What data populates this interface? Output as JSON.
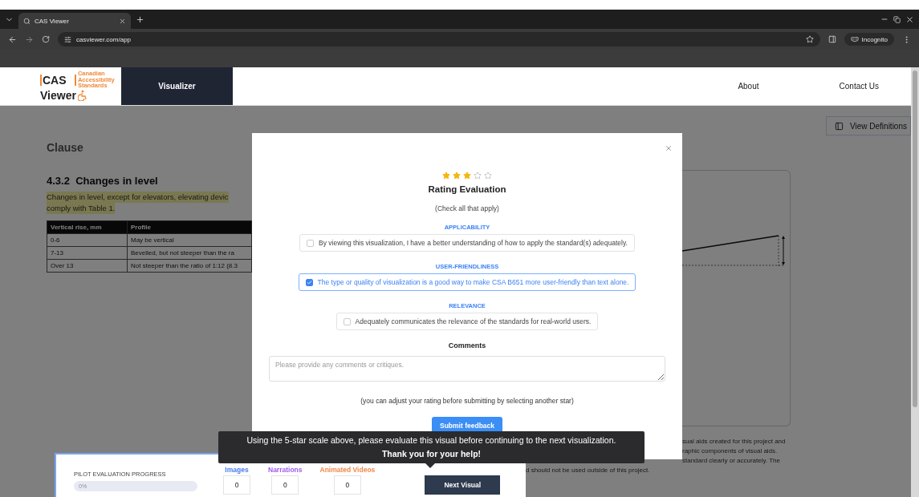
{
  "browser": {
    "tab_title": "CAS Viewer",
    "url": "casviewer.com/app",
    "profile": "Incognito"
  },
  "nav": {
    "logo": {
      "top": "CAS",
      "bottom": "Viewer",
      "tagline": [
        "Canadian",
        "Accessibility",
        "Standards"
      ]
    },
    "items": [
      {
        "label": "Visualizer",
        "selected": true
      },
      {
        "label": "About",
        "selected": false
      },
      {
        "label": "Contact Us",
        "selected": false
      }
    ]
  },
  "content": {
    "heading": "Clause",
    "clause_title": "4.3.2  Changes in level",
    "clause_text": [
      "Changes in level, except for elevators, elevating devic",
      "comply with Table 1."
    ],
    "table": {
      "columns": [
        "Vertical rise, mm",
        "Profile"
      ],
      "rows": [
        [
          "0-6",
          "May be vertical"
        ],
        [
          "7-13",
          "Bevelled, but not steeper than the ra"
        ],
        [
          "Over 13",
          "Not steeper than the ratio of 1:12 (8.3"
        ]
      ]
    },
    "definitions_button": "View Definitions",
    "disclaimer": [
      {
        "text": "sual aids created for this project and",
        "indented": true
      },
      {
        "text": "raphic components of visual aids.",
        "indented": true
      },
      {
        "text": "standard clearly or accurately. The",
        "indented": true
      },
      {
        "text": "d should not be used outside of this project.",
        "indented": false
      }
    ]
  },
  "modal": {
    "stars": 3,
    "title": "Rating Evaluation",
    "subtitle": "(Check all that apply)",
    "options": [
      {
        "category": "APPLICABILITY",
        "text": "By viewing this visualization, I have a better understanding of how to apply the standard(s) adequately.",
        "checked": false
      },
      {
        "category": "USER-FRIENDLINESS",
        "text": "The type or quality of visualization is a good way to make CSA B651 more user-friendly than text alone.",
        "checked": true
      },
      {
        "category": "RELEVANCE",
        "text": "Adequately communicates the relevance of the standards for real-world users.",
        "checked": false
      }
    ],
    "comments_label": "Comments",
    "comments_placeholder": "Please provide any comments or critiques.",
    "hint": "(you can adjust your rating before submitting by selecting another star)",
    "submit": "Submit feedback"
  },
  "progress": {
    "title": "PILOT EVALUATION PROGRESS",
    "level": 0,
    "percent": "0%",
    "counters": [
      {
        "label": "Images",
        "value": "0",
        "color": "#4a7cf0"
      },
      {
        "label": "Narrations",
        "value": "0",
        "color": "#a05cf0"
      },
      {
        "label": "Animated Videos",
        "value": "0",
        "color": "#f0884a"
      }
    ],
    "next": "Next Visual"
  },
  "tooltip": {
    "line1": "Using the 5-star scale above, please evaluate this visual before continuing to the next visualization.",
    "line2": "Thank you for your help!"
  }
}
